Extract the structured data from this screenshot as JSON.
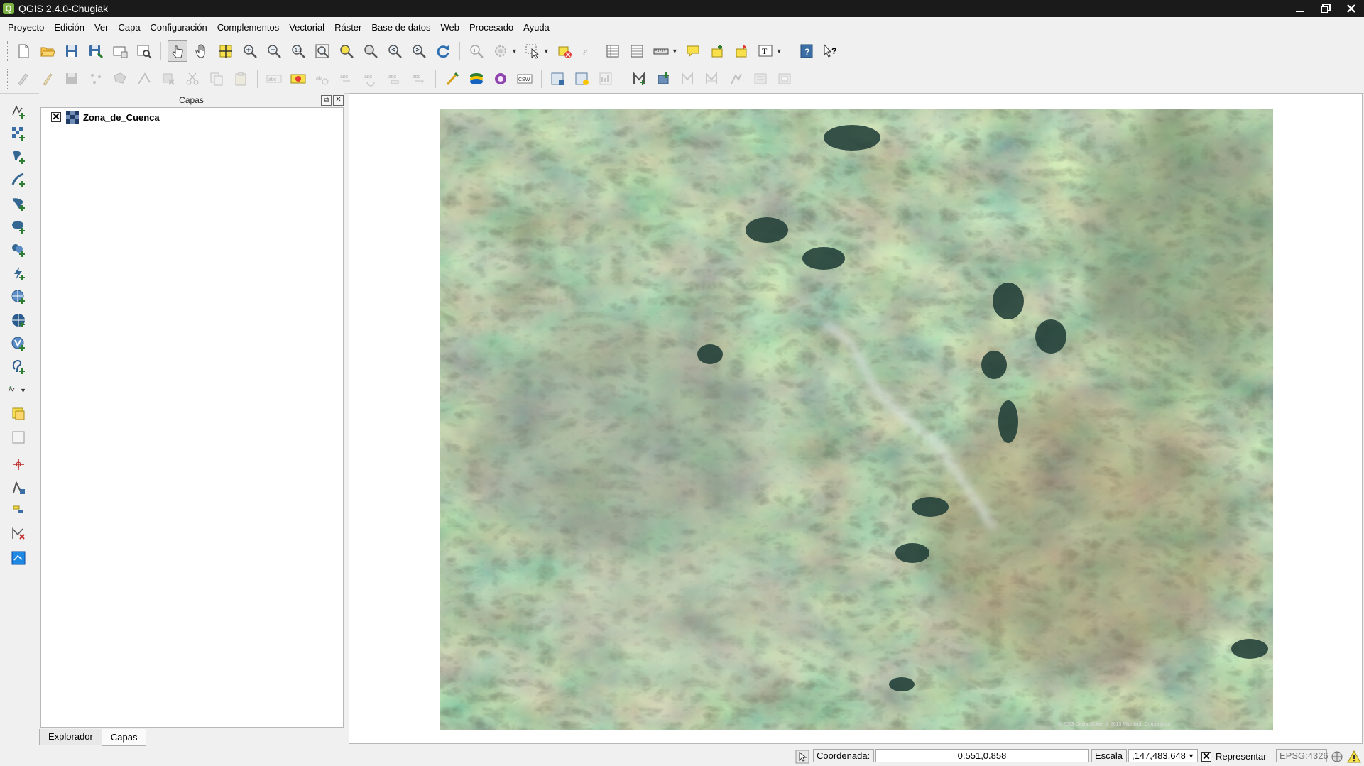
{
  "window": {
    "title": "QGIS 2.4.0-Chugiak",
    "logo": "Q",
    "buttons": [
      "minimize",
      "maximize",
      "close"
    ]
  },
  "menubar": {
    "items": [
      "Proyecto",
      "Edición",
      "Ver",
      "Capa",
      "Configuración",
      "Complementos",
      "Vectorial",
      "Ráster",
      "Base de datos",
      "Web",
      "Procesado",
      "Ayuda"
    ]
  },
  "toolbar1": {
    "icons": [
      "new-project-icon",
      "open-project-icon",
      "save-project-icon",
      "save-as-icon",
      "new-print-composer-icon",
      "composer-manager-icon",
      "touch-zoom-icon",
      "pan-icon",
      "pan-to-selection-icon",
      "zoom-in-icon",
      "zoom-out-icon",
      "zoom-actual-size-icon",
      "zoom-full-icon",
      "zoom-to-selection-icon",
      "zoom-to-layer-icon",
      "zoom-last-icon",
      "zoom-next-icon",
      "refresh-icon",
      "identify-icon",
      "run-feature-action-icon",
      "select-features-icon",
      "deselect-icon",
      "field-calculator-icon",
      "attribute-table-icon",
      "statistical-summary-icon",
      "measure-icon",
      "map-tips-icon",
      "new-bookmark-icon",
      "show-bookmarks-icon",
      "text-annotation-icon",
      "help-contents-icon",
      "whats-this-icon"
    ]
  },
  "toolbar2": {
    "icons": [
      "current-edits-icon",
      "toggle-editing-icon",
      "save-layer-edits-icon",
      "add-feature-icon",
      "move-feature-icon",
      "node-tool-icon",
      "delete-selected-icon",
      "cut-features-icon",
      "copy-features-icon",
      "paste-features-icon",
      "layer-labeling-icon",
      "pin-labels-icon",
      "show-hide-labels-icon",
      "move-label-icon",
      "rotate-label-icon",
      "change-label-icon",
      "label-options-icon",
      "python-console-icon",
      "openlayers-plugin-icon",
      "georeferencer-icon",
      "csw-icon",
      "raster-calculator-icon",
      "raster-histogram-icon",
      "raster-stretch-icon",
      "add-polygon-icon",
      "reshape-features-icon",
      "split-features-icon",
      "merge-features-icon",
      "rotate-features-icon",
      "simplify-feature-icon",
      "fill-ring-icon"
    ],
    "csw_label": "CSW"
  },
  "lefttoolbar": {
    "icons": [
      "add-vector-layer-icon",
      "add-raster-layer-icon",
      "add-postgis-layer-icon",
      "add-spatialite-layer-icon",
      "add-mssql-layer-icon",
      "add-oracle-layer-icon",
      "add-virtual-layer-icon",
      "add-delimited-text-icon",
      "add-wms-layer-icon",
      "add-wcs-layer-icon",
      "add-wfs-layer-icon",
      "add-gpx-layer-icon",
      "new-shapefile-layer-icon",
      "new-spatialite-layer-icon",
      "remove-layer-icon",
      "digitize-point-icon",
      "add-part-icon",
      "split-parts-icon",
      "vertex-editor-icon",
      "fill-polygon-icon"
    ]
  },
  "layers_panel": {
    "title": "Capas",
    "layers": [
      {
        "name": "Zona_de_Cuenca",
        "checked": true,
        "type": "raster"
      }
    ],
    "tabs": [
      "Explorador",
      "Capas"
    ],
    "active_tab": "Capas"
  },
  "map": {
    "layer": "Zona_de_Cuenca",
    "attribution": "© 2013 DigitalGlobe, © 2013 Microsoft Corporation"
  },
  "statusbar": {
    "coord_label": "Coordenada:",
    "coord_value": "0.551,0.858",
    "scale_label": "Escala",
    "scale_value": ",147,483,648",
    "render_label": "Representar",
    "render_checked": true,
    "crs": "EPSG:4326"
  },
  "colors": {
    "titlebar": "#1a1a1a",
    "qgis_green": "#7cb342",
    "background": "#f0f0f0"
  }
}
